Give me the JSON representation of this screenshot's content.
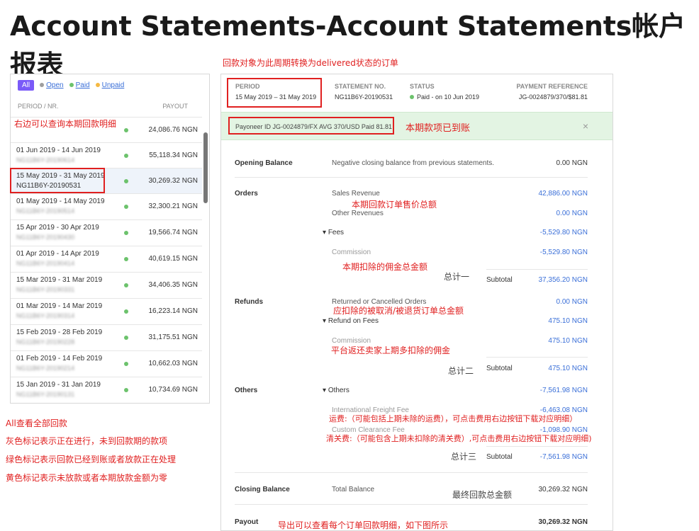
{
  "title": "Account Statements-Account Statements帐户报表",
  "left": {
    "filters": {
      "all": "All",
      "open": "Open",
      "paid": "Paid",
      "unpaid": "Unpaid",
      "open_color": "#9e9e9e",
      "paid_color": "#6cc26c",
      "unpaid_color": "#f5b942"
    },
    "header": {
      "period": "PERIOD / NR.",
      "payout": "PAYOUT"
    },
    "rows": [
      {
        "period": "",
        "sub": "",
        "amount": "24,086.76 NGN"
      },
      {
        "period": "01 Jun 2019 - 14 Jun 2019",
        "sub": "NG11B6Y-20190614",
        "amount": "55,118.34 NGN"
      },
      {
        "period": "15 May 2019 - 31 May 2019",
        "sub": "NG11B6Y-20190531",
        "amount": "30,269.32 NGN"
      },
      {
        "period": "01 May 2019 - 14 May 2019",
        "sub": "NG11B6Y-20190514",
        "amount": "32,300.21 NGN"
      },
      {
        "period": "15 Apr 2019 - 30 Apr 2019",
        "sub": "NG11B6Y-20190430",
        "amount": "19,566.74 NGN"
      },
      {
        "period": "01 Apr 2019 - 14 Apr 2019",
        "sub": "NG11B6Y-20190414",
        "amount": "40,619.15 NGN"
      },
      {
        "period": "15 Mar 2019 - 31 Mar 2019",
        "sub": "NG11B6Y-20190331",
        "amount": "34,406.35 NGN"
      },
      {
        "period": "01 Mar 2019 - 14 Mar 2019",
        "sub": "NG11B6Y-20190314",
        "amount": "16,223.14 NGN"
      },
      {
        "period": "15 Feb 2019 - 28 Feb 2019",
        "sub": "NG11B6Y-20190228",
        "amount": "31,175.51 NGN"
      },
      {
        "period": "01 Feb 2019 - 14 Feb 2019",
        "sub": "NG11B6Y-20190214",
        "amount": "10,662.03 NGN"
      },
      {
        "period": "15 Jan 2019 - 31 Jan 2019",
        "sub": "NG11B6Y-20190131",
        "amount": "10,734.69 NGN"
      }
    ]
  },
  "right": {
    "head": {
      "period_label": "PERIOD",
      "period_value": "15 May 2019 – 31 May 2019",
      "stmt_label": "STATEMENT NO.",
      "stmt_value": "NG11B6Y-20190531",
      "status_label": "STATUS",
      "status_value": "Paid - on 10 Jun 2019",
      "payref_label": "PAYMENT REFERENCE",
      "payref_value": "JG-0024879/370/$81.81"
    },
    "banner": {
      "text": "Payoneer ID JG-0024879/FX AVG 370/USD Paid 81.81",
      "close": "×"
    },
    "opening": {
      "label": "Opening Balance",
      "desc": "Negative closing balance from previous statements.",
      "amount": "0.00 NGN"
    },
    "orders": {
      "label": "Orders",
      "sales_label": "Sales Revenue",
      "sales_amount": "42,886.00 NGN",
      "other_label": "Other Revenues",
      "other_amount": "0.00 NGN",
      "fees_label": "Fees",
      "fees_amount": "-5,529.80 NGN",
      "commission_label": "Commission",
      "commission_amount": "-5,529.80 NGN",
      "subtotal_label": "Subtotal",
      "subtotal_amount": "37,356.20 NGN"
    },
    "refunds": {
      "label": "Refunds",
      "returned_label": "Returned or Cancelled Orders",
      "returned_amount": "0.00 NGN",
      "rof_label": "Refund on Fees",
      "rof_amount": "475.10 NGN",
      "commission_label": "Commission",
      "commission_amount": "475.10 NGN",
      "subtotal_label": "Subtotal",
      "subtotal_amount": "475.10 NGN"
    },
    "others": {
      "label": "Others",
      "others_label": "Others",
      "others_amount": "-7,561.98 NGN",
      "freight_label": "International Freight Fee",
      "freight_amount": "-6,463.08 NGN",
      "customs_label": "Custom Clearance Fee",
      "customs_amount": "-1,098.90 NGN",
      "subtotal_label": "Subtotal",
      "subtotal_amount": "-7,561.98 NGN"
    },
    "closing": {
      "label": "Closing Balance",
      "desc": "Total Balance",
      "amount": "30,269.32 NGN"
    },
    "payout": {
      "label": "Payout",
      "amount": "30,269.32 NGN"
    }
  },
  "annotations": {
    "top": "回款对象为此周期转换为delivered状态的订单",
    "left_detail": "右边可以查询本期回款明细",
    "paid": "本期款项已到账",
    "sales": "本期回款订单售价总额",
    "commission": "本期扣除的佣金总金额",
    "total1": "总计一",
    "refund": "应扣除的被取消/被退货订单总金额",
    "refund_comm": "平台返还卖家上期多扣除的佣金",
    "total2": "总计二",
    "freight": "运费:（可能包括上期未除的运费），可点击费用右边按钮下载对应明细）",
    "customs": "清关费:（可能包含上期未扣除的清关费）,可点击费用右边按钮下载对应明细)",
    "total3": "总计三",
    "final": "最终回款总金额",
    "export": "导出可以查看每个订单回款明细，如下图所示",
    "legend_all": "All查看全部回款",
    "legend_gray": "灰色标记表示正在进行，未到回款期的款项",
    "legend_green": "绿色标记表示回款已经到账或者放款正在处理",
    "legend_yellow": "黄色标记表示未放款或者本期放款金额为零"
  }
}
